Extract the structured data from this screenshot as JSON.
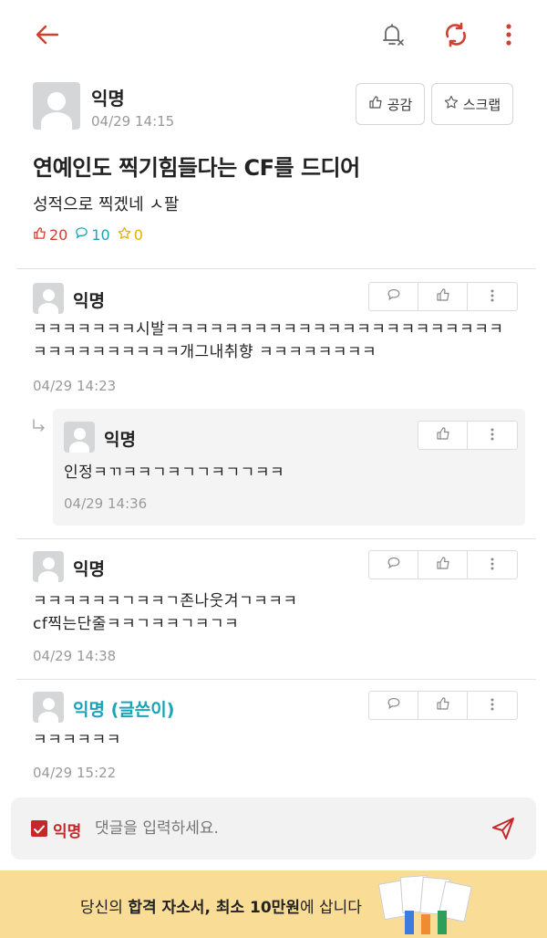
{
  "topbar": {
    "back_icon": "arrow-left-icon",
    "bell_icon": "bell-off-icon",
    "refresh_icon": "refresh-icon",
    "more_icon": "more-vertical-icon",
    "accent": "#d0402f"
  },
  "post": {
    "author": "익명",
    "time": "04/29 14:15",
    "like_button": "공감",
    "scrap_button": "스크랩",
    "title": "연예인도 찍기힘들다는 CF를 드디어",
    "body": "성적으로 찍겠네 ㅅ팔",
    "likes": "20",
    "comments": "10",
    "scraps": "0"
  },
  "comments": [
    {
      "author": "익명",
      "lines": [
        "ㅋㅋㅋㅋㅋㅋㅋ시발ㅋㅋㅋㅋㅋㅋㅋㅋㅋㅋㅋㅋㅋㅋㅋㅋㅋㅋㅋㅋㅋㅋㅋ",
        "ㅋㅋㅋㅋㅋㅋㅋㅋㅋㅋ개그내취향 ㅋㅋㅋㅋㅋㅋㅋㅋ"
      ],
      "time": "04/29 14:23"
    },
    {
      "author": "익명",
      "lines": [
        "인정ㅋㄲㅋㅋㄱㅋㄱㄱㅋㄱㄱㅋㅋ"
      ],
      "time": "04/29 14:36",
      "is_reply": true
    },
    {
      "author": "익명",
      "lines": [
        "ㅋㅋㅋㅋㅋㅋㄱㅋㅋㄱ존나웃겨ㄱㅋㅋㅋ",
        "cf찍는단줄ㅋㅋㄱㅋㅋㄱㅋㄱㅋ"
      ],
      "time": "04/29 14:38"
    },
    {
      "author": "익명 (글쓴이)",
      "lines": [
        "ㅋㅋㅋㅋㅋㅋ"
      ],
      "time": "04/29 15:22",
      "is_writer": true,
      "writer_color": "#1ba3b8"
    }
  ],
  "input": {
    "anon_label": "익명",
    "placeholder": "댓글을 입력하세요.",
    "send_icon": "send-icon"
  },
  "banner": {
    "prefix": "당신의 ",
    "bold1": "합격 자소서, 최소 10만원",
    "suffix": "에 삽니다"
  }
}
